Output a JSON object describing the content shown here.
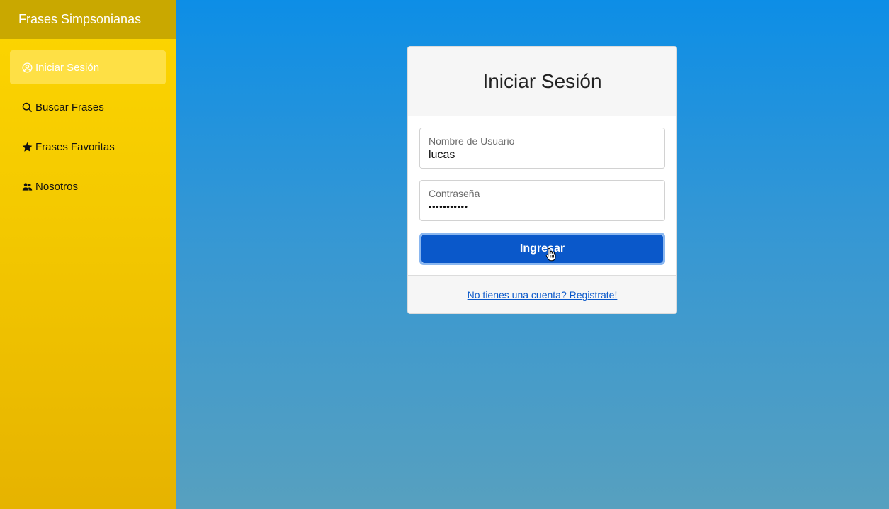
{
  "sidebar": {
    "brand": "Frases Simpsonianas",
    "items": [
      {
        "label": "Iniciar Sesión",
        "icon": "user-circle-icon",
        "active": true
      },
      {
        "label": "Buscar Frases",
        "icon": "search-icon",
        "active": false
      },
      {
        "label": "Frases Favoritas",
        "icon": "star-icon",
        "active": false
      },
      {
        "label": "Nosotros",
        "icon": "people-icon",
        "active": false
      }
    ]
  },
  "login": {
    "title": "Iniciar Sesión",
    "username": {
      "label": "Nombre de Usuario",
      "value": "lucas"
    },
    "password": {
      "label": "Contraseña",
      "value": "•••••••••••"
    },
    "submit_label": "Ingresar",
    "register_link": "No tienes una cuenta? Registrate!"
  },
  "colors": {
    "sidebar_accent": "#fdd600",
    "brand_bar": "#c9a800",
    "primary_button": "#0a58ca",
    "background_top": "#0d8ee6"
  }
}
